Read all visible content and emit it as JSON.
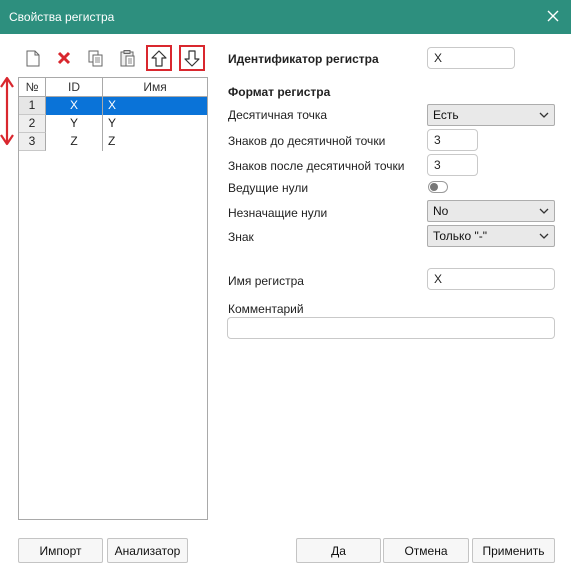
{
  "window": {
    "title": "Свойства регистра"
  },
  "toolbar": {
    "icons": [
      "new-file-icon",
      "delete-icon",
      "copy-icon",
      "paste-icon",
      "move-up-icon",
      "move-down-icon"
    ]
  },
  "grid": {
    "headers": {
      "num": "№",
      "id": "ID",
      "name": "Имя"
    },
    "rows": [
      {
        "num": "1",
        "id": "X",
        "name": "X",
        "selected": true
      },
      {
        "num": "2",
        "id": "Y",
        "name": "Y"
      },
      {
        "num": "3",
        "id": "Z",
        "name": "Z"
      }
    ]
  },
  "form": {
    "identifier_label": "Идентификатор регистра",
    "identifier_value": "X",
    "format_section": "Формат регистра",
    "decimal_point_label": "Десятичная точка",
    "decimal_point_value": "Есть",
    "digits_before_label": "Знаков до десятичной точки",
    "digits_before_value": "3",
    "digits_after_label": "Знаков после десятичной точки",
    "digits_after_value": "3",
    "leading_zeros_label": "Ведущие нули",
    "leading_zeros_on": false,
    "trailing_zeros_label": "Незначащие нули",
    "trailing_zeros_value": "No",
    "sign_label": "Знак",
    "sign_value": "Только \"-\"",
    "register_name_label": "Имя регистра",
    "register_name_value": "X",
    "comment_label": "Комментарий",
    "comment_value": ""
  },
  "buttons": {
    "import": "Импорт",
    "analyzer": "Анализатор",
    "ok": "Да",
    "cancel": "Отмена",
    "apply": "Применить"
  },
  "colors": {
    "titlebar": "#2d8f7e",
    "selection": "#0a73d8",
    "highlight_red": "#d9272e"
  }
}
